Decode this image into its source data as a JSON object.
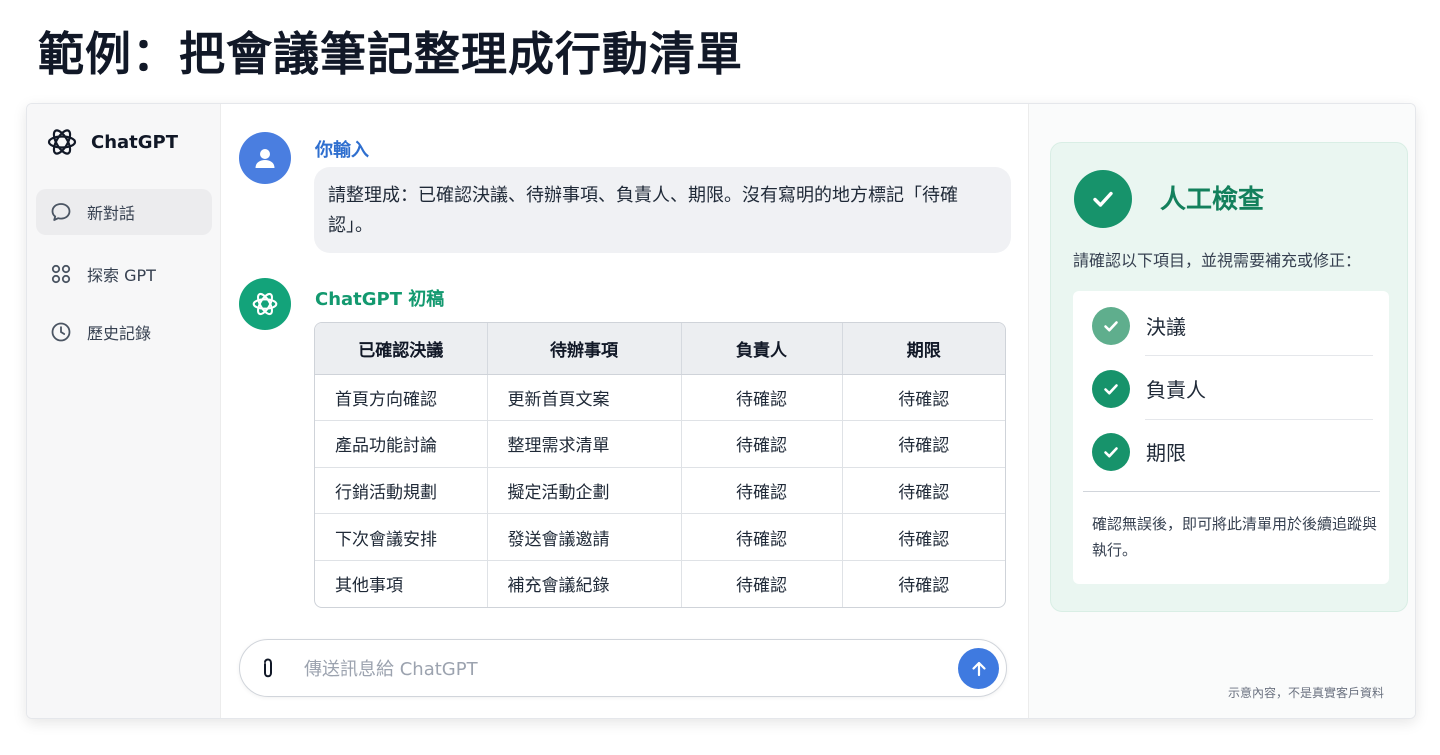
{
  "page": {
    "title": "範例：把會議筆記整理成行動清單"
  },
  "sidebar": {
    "brand": "ChatGPT",
    "items": [
      {
        "label": "新對話",
        "icon": "chat-bubble-icon",
        "active": true
      },
      {
        "label": "探索 GPT",
        "icon": "grid-icon",
        "active": false
      },
      {
        "label": "歷史記錄",
        "icon": "clock-icon",
        "active": false
      }
    ]
  },
  "chat": {
    "user_name": "你輸入",
    "user_message": "請整理成：已確認決議、待辦事項、負責人、期限。沒有寫明的地方標記「待確認」。",
    "assistant_name": "ChatGPT 初稿",
    "table": {
      "headers": [
        "已確認決議",
        "待辦事項",
        "負責人",
        "期限"
      ],
      "rows": [
        [
          "首頁方向確認",
          "更新首頁文案",
          "待確認",
          "待確認"
        ],
        [
          "產品功能討論",
          "整理需求清單",
          "待確認",
          "待確認"
        ],
        [
          "行銷活動規劃",
          "擬定活動企劃",
          "待確認",
          "待確認"
        ],
        [
          "下次會議安排",
          "發送會議邀請",
          "待確認",
          "待確認"
        ],
        [
          "其他事項",
          "補充會議紀錄",
          "待確認",
          "待確認"
        ]
      ]
    },
    "composer": {
      "placeholder": "傳送訊息給 ChatGPT"
    }
  },
  "review": {
    "title": "人工檢查",
    "subtitle": "請確認以下項目，並視需要補充或修正：",
    "items": [
      {
        "label": "決議",
        "color": "#5fae8d"
      },
      {
        "label": "負責人",
        "color": "#17936b"
      },
      {
        "label": "期限",
        "color": "#17936b"
      }
    ],
    "note": "確認無誤後，即可將此清單用於後續追蹤與執行。"
  },
  "footer": {
    "disclaimer": "示意內容，不是真實客戶資料"
  },
  "colors": {
    "accent_blue": "#3f7ae0",
    "accent_green": "#17936b"
  }
}
